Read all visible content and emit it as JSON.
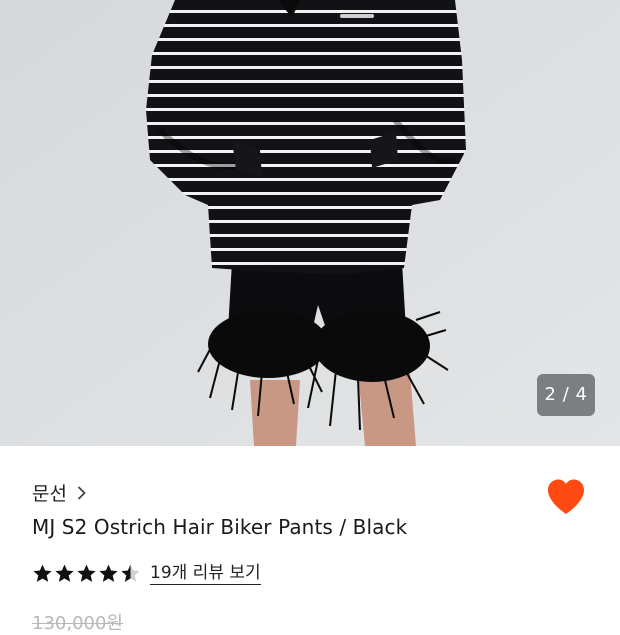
{
  "image": {
    "counter": "2 / 4"
  },
  "brand": {
    "name": "문선",
    "chevron_icon": "chevron-right-icon"
  },
  "product": {
    "name": "MJ S2 Ostrich Hair Biker Pants / Black",
    "original_price": "130,000원"
  },
  "rating": {
    "value": 4.5,
    "max": 5,
    "review_label": "19개 리뷰 보기"
  },
  "wishlist": {
    "icon": "heart-icon",
    "color": "#ff4b13",
    "active": true
  }
}
